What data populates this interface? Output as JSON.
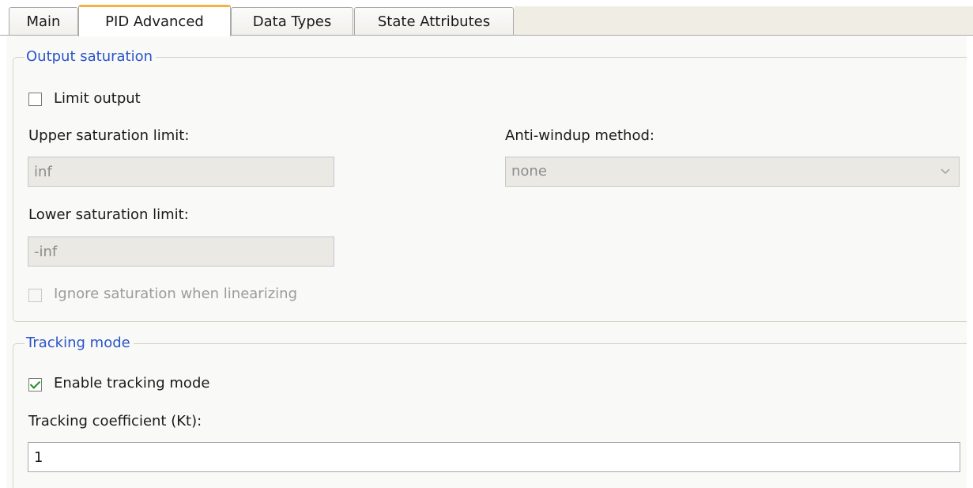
{
  "tabs": [
    {
      "label": "Main",
      "active": false
    },
    {
      "label": "PID Advanced",
      "active": true
    },
    {
      "label": "Data Types",
      "active": false
    },
    {
      "label": "State Attributes",
      "active": false
    }
  ],
  "output_saturation": {
    "legend": "Output saturation",
    "limit_output": {
      "label": "Limit output",
      "checked": false
    },
    "upper_limit": {
      "label": "Upper saturation limit:",
      "value": "inf"
    },
    "lower_limit": {
      "label": "Lower saturation limit:",
      "value": "-inf"
    },
    "anti_windup": {
      "label": "Anti-windup method:",
      "value": "none"
    },
    "ignore_saturation": {
      "label": "Ignore saturation when linearizing",
      "checked": false,
      "enabled": false
    }
  },
  "tracking_mode": {
    "legend": "Tracking mode",
    "enable_tracking": {
      "label": "Enable tracking mode",
      "checked": true
    },
    "tracking_coefficient": {
      "label": "Tracking coefficient (Kt):",
      "value": "1"
    }
  },
  "colors": {
    "legend_text": "#2a55c9",
    "active_tab_accent": "#f5b342",
    "check_mark": "#1f8f1f"
  },
  "icons": {
    "dropdown": "chevron-down-icon",
    "check": "check-icon"
  }
}
